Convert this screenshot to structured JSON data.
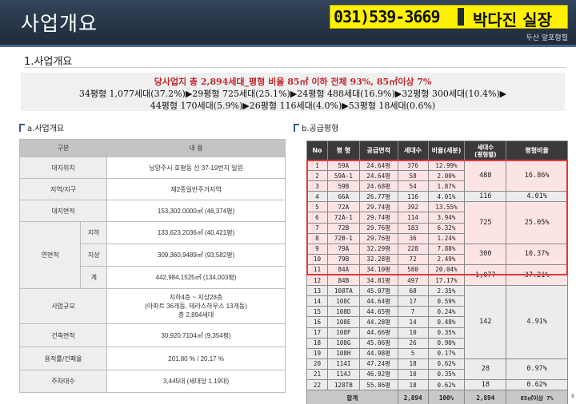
{
  "header": {
    "title": "사업개요",
    "phone": "031)539-3669",
    "contact_name": "박다진 실장",
    "subtitle": "두산 앞포형힐"
  },
  "section": {
    "title": "1.사업개요"
  },
  "summary": {
    "line1": "당사업지 총 2,894세대_평형 비율 85㎡ 이하 전체 93%, 85㎡이상 7%",
    "line2": "34평형 1,077세대(37.2%)▶29평형 725세대(25.1%)▶24평형 488세대(16.9%)▶32평형 300세대(10.4%)▶",
    "line3": "44평형 170세대(5.9%)▶26평형 116세대(4.0%)▶53평형 18세대(0.6%)"
  },
  "left": {
    "heading": "a.사업개요",
    "col_headers": [
      "구분",
      "내 용"
    ],
    "rows": {
      "location_label": "대지위치",
      "location": "남양주시 호평동 산 37-19번지 일원",
      "zone_label": "지역/지구",
      "zone": "제2종일반주거지역",
      "site_label": "대지면적",
      "site": "153,302.0000㎡ (46,374평)",
      "floor_label": "연면적",
      "under_label": "지하",
      "under": "133,623,2036㎡ (40,421평)",
      "above_label": "지상",
      "above": "309,360,9489㎡ (93,582평)",
      "total_label": "계",
      "total": "442,984,1525㎡ (134,003평)",
      "scale_label": "사업규모",
      "scale1": "지하4층 ~ 지상28층",
      "scale2": "(아파트 36개동, 테라스하우스 13개동)",
      "scale3": "총 2,894세대",
      "build_label": "건축면적",
      "build": "30,920.7104㎡ (9,354평)",
      "ratio_label": "용적률/건폐율",
      "ratio": "201.80 % / 20.17 %",
      "parking_label": "주차대수",
      "parking": "3,445대 (세대당 1.19대)"
    }
  },
  "right": {
    "heading": "b.공급평형",
    "col_headers": [
      "No",
      "평 형",
      "공급면적",
      "세대수",
      "비율(세분)",
      "세대수\n(평형별)",
      "평형비율"
    ],
    "rows": [
      {
        "no": "1",
        "type": "59A",
        "area": "24.64평",
        "units": "376",
        "ratio": "12.99%"
      },
      {
        "no": "2",
        "type": "59A-1",
        "area": "24.64평",
        "units": "58",
        "ratio": "2.00%"
      },
      {
        "no": "3",
        "type": "59B",
        "area": "24.68평",
        "units": "54",
        "ratio": "1.87%"
      },
      {
        "no": "4",
        "type": "66A",
        "area": "26.77평",
        "units": "116",
        "ratio": "4.01%"
      },
      {
        "no": "5",
        "type": "72A",
        "area": "29.74평",
        "units": "392",
        "ratio": "13.55%"
      },
      {
        "no": "6",
        "type": "72A-1",
        "area": "29.74평",
        "units": "114",
        "ratio": "3.94%"
      },
      {
        "no": "7",
        "type": "72B",
        "area": "29.76평",
        "units": "183",
        "ratio": "6.32%"
      },
      {
        "no": "8",
        "type": "72B-1",
        "area": "29.76평",
        "units": "36",
        "ratio": "1.24%"
      },
      {
        "no": "9",
        "type": "79A",
        "area": "32.29평",
        "units": "228",
        "ratio": "7.88%"
      },
      {
        "no": "10",
        "type": "79B",
        "area": "32.28평",
        "units": "72",
        "ratio": "2.49%"
      },
      {
        "no": "11",
        "type": "84A",
        "area": "34.10평",
        "units": "580",
        "ratio": "20.04%"
      },
      {
        "no": "12",
        "type": "84B",
        "area": "34.81평",
        "units": "497",
        "ratio": "17.17%"
      },
      {
        "no": "13",
        "type": "108TA",
        "area": "45.07평",
        "units": "68",
        "ratio": "2.35%"
      },
      {
        "no": "14",
        "type": "108C",
        "area": "44.64평",
        "units": "17",
        "ratio": "0.59%"
      },
      {
        "no": "15",
        "type": "108D",
        "area": "44.65평",
        "units": "7",
        "ratio": "0.24%"
      },
      {
        "no": "16",
        "type": "108E",
        "area": "44.28평",
        "units": "14",
        "ratio": "0.48%"
      },
      {
        "no": "17",
        "type": "108F",
        "area": "44.66평",
        "units": "10",
        "ratio": "0.35%"
      },
      {
        "no": "18",
        "type": "108G",
        "area": "45.06평",
        "units": "26",
        "ratio": "0.90%"
      },
      {
        "no": "19",
        "type": "108H",
        "area": "44.98평",
        "units": "5",
        "ratio": "0.17%"
      },
      {
        "no": "20",
        "type": "114I",
        "area": "47.24평",
        "units": "18",
        "ratio": "0.62%"
      },
      {
        "no": "21",
        "type": "114J",
        "area": "46.92평",
        "units": "10",
        "ratio": "0.35%"
      },
      {
        "no": "22",
        "type": "128TB",
        "area": "55.86평",
        "units": "18",
        "ratio": "0.62%"
      }
    ],
    "groups": [
      {
        "units": "488",
        "ratio": "16.86%"
      },
      {
        "units": "116",
        "ratio": "4.01%"
      },
      {
        "units": "725",
        "ratio": "25.05%"
      },
      {
        "units": "300",
        "ratio": "10.37%"
      },
      {
        "units": "1,077",
        "ratio": "37.21%"
      },
      {
        "units": "142",
        "ratio": "4.91%"
      },
      {
        "units": "28",
        "ratio": "0.97%"
      },
      {
        "units": "18",
        "ratio": "0.62%"
      }
    ],
    "total": {
      "label": "합계",
      "units": "2,894",
      "ratio": "100%",
      "units2": "2,894",
      "note": "85㎡이상 7%"
    }
  },
  "page_number": "8"
}
